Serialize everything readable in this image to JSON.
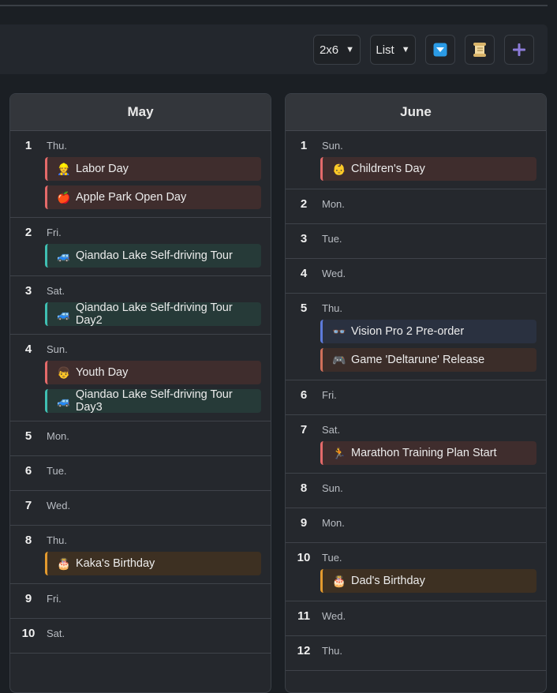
{
  "toolbar": {
    "layout_value": "2x6",
    "view_value": "List",
    "filter_icon": "filter-icon",
    "scroll_icon": "scroll-icon",
    "add_icon": "plus-icon"
  },
  "months": [
    {
      "name": "May",
      "days": [
        {
          "num": "1",
          "wd": "Thu.",
          "events": [
            {
              "emoji": "👷",
              "title": "Labor Day",
              "color": "red"
            },
            {
              "emoji": "🍎",
              "title": "Apple Park Open Day",
              "color": "red"
            }
          ]
        },
        {
          "num": "2",
          "wd": "Fri.",
          "events": [
            {
              "emoji": "🚙",
              "title": "Qiandao Lake Self-driving Tour",
              "color": "teal"
            }
          ]
        },
        {
          "num": "3",
          "wd": "Sat.",
          "events": [
            {
              "emoji": "🚙",
              "title": "Qiandao Lake Self-driving Tour Day2",
              "color": "teal"
            }
          ]
        },
        {
          "num": "4",
          "wd": "Sun.",
          "events": [
            {
              "emoji": "👦",
              "title": "Youth Day",
              "color": "red"
            },
            {
              "emoji": "🚙",
              "title": "Qiandao Lake Self-driving Tour Day3",
              "color": "teal"
            }
          ]
        },
        {
          "num": "5",
          "wd": "Mon.",
          "events": []
        },
        {
          "num": "6",
          "wd": "Tue.",
          "events": []
        },
        {
          "num": "7",
          "wd": "Wed.",
          "events": []
        },
        {
          "num": "8",
          "wd": "Thu.",
          "events": [
            {
              "emoji": "🎂",
              "title": "Kaka's Birthday",
              "color": "orange"
            }
          ]
        },
        {
          "num": "9",
          "wd": "Fri.",
          "events": []
        },
        {
          "num": "10",
          "wd": "Sat.",
          "events": []
        }
      ]
    },
    {
      "name": "June",
      "days": [
        {
          "num": "1",
          "wd": "Sun.",
          "events": [
            {
              "emoji": "👶",
              "title": "Children's Day",
              "color": "red"
            }
          ]
        },
        {
          "num": "2",
          "wd": "Mon.",
          "events": []
        },
        {
          "num": "3",
          "wd": "Tue.",
          "events": []
        },
        {
          "num": "4",
          "wd": "Wed.",
          "events": []
        },
        {
          "num": "5",
          "wd": "Thu.",
          "events": [
            {
              "emoji": "👓",
              "title": "Vision Pro 2 Pre-order",
              "color": "blue"
            },
            {
              "emoji": "🎮",
              "title": "Game 'Deltarune' Release",
              "color": "brown"
            }
          ]
        },
        {
          "num": "6",
          "wd": "Fri.",
          "events": []
        },
        {
          "num": "7",
          "wd": "Sat.",
          "events": [
            {
              "emoji": "🏃",
              "title": "Marathon Training Plan Start",
              "color": "red"
            }
          ]
        },
        {
          "num": "8",
          "wd": "Sun.",
          "events": []
        },
        {
          "num": "9",
          "wd": "Mon.",
          "events": []
        },
        {
          "num": "10",
          "wd": "Tue.",
          "events": [
            {
              "emoji": "🎂",
              "title": "Dad's Birthday",
              "color": "orange"
            }
          ]
        },
        {
          "num": "11",
          "wd": "Wed.",
          "events": []
        },
        {
          "num": "12",
          "wd": "Thu.",
          "events": []
        }
      ]
    }
  ]
}
